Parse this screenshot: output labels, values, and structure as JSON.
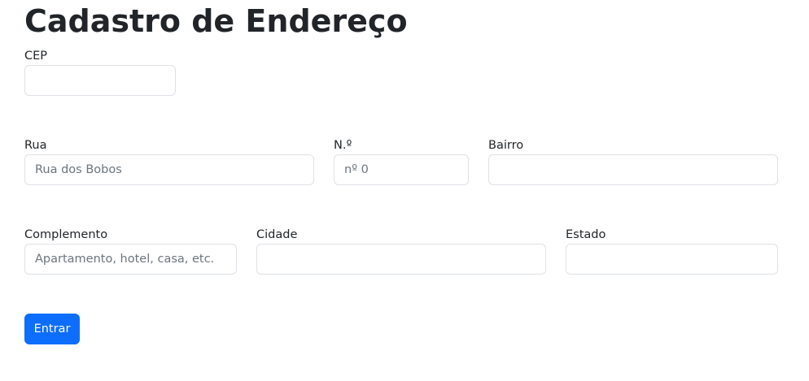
{
  "page": {
    "title": "Cadastro de Endereço"
  },
  "form": {
    "cep": {
      "label": "CEP",
      "value": "",
      "placeholder": ""
    },
    "rua": {
      "label": "Rua",
      "value": "",
      "placeholder": "Rua dos Bobos"
    },
    "numero": {
      "label": "N.º",
      "value": "",
      "placeholder": "nº 0"
    },
    "bairro": {
      "label": "Bairro",
      "value": "",
      "placeholder": ""
    },
    "complemento": {
      "label": "Complemento",
      "value": "",
      "placeholder": "Apartamento, hotel, casa, etc."
    },
    "cidade": {
      "label": "Cidade",
      "value": "",
      "placeholder": ""
    },
    "estado": {
      "label": "Estado",
      "value": "",
      "placeholder": ""
    },
    "submit_label": "Entrar"
  },
  "colors": {
    "primary": "#0d6efd",
    "border": "#dee2e6",
    "text": "#212529",
    "placeholder": "#6c757d"
  }
}
